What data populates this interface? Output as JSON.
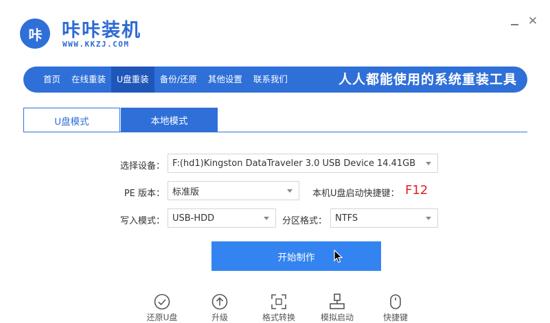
{
  "brand": {
    "logo_text": "咔",
    "name": "咔咔装机",
    "url": "WWW.KKZJ.COM",
    "color": "#2f6fd8"
  },
  "window_controls": {
    "minimize": "—",
    "close": "✕"
  },
  "nav": {
    "items": [
      {
        "label": "首页",
        "active": false
      },
      {
        "label": "在线重装",
        "active": false
      },
      {
        "label": "U盘重装",
        "active": true
      },
      {
        "label": "备份/还原",
        "active": false
      },
      {
        "label": "其他设置",
        "active": false
      },
      {
        "label": "联系我们",
        "active": false
      }
    ],
    "slogan": "人人都能使用的系统重装工具"
  },
  "tabs": [
    {
      "label": "U盘模式",
      "active": true
    },
    {
      "label": "本地模式",
      "active": false
    }
  ],
  "form": {
    "device_label": "选择设备：",
    "device_value": "F:(hd1)Kingston DataTraveler 3.0 USB Device 14.41GB",
    "pe_label": "PE 版本：",
    "pe_value": "标准版",
    "hotkey_label": "本机U盘启动快捷键：",
    "hotkey_value": "F12",
    "write_label": "写入模式：",
    "write_value": "USB-HDD",
    "partition_label": "分区格式：",
    "partition_value": "NTFS"
  },
  "start_button": "开始制作",
  "bottom_icons": [
    {
      "icon": "check-circle-icon",
      "label": "还原U盘"
    },
    {
      "icon": "upgrade-icon",
      "label": "升级"
    },
    {
      "icon": "convert-icon",
      "label": "格式转换"
    },
    {
      "icon": "simulate-boot-icon",
      "label": "模拟启动"
    },
    {
      "icon": "shortcut-key-icon",
      "label": "快捷键"
    }
  ]
}
